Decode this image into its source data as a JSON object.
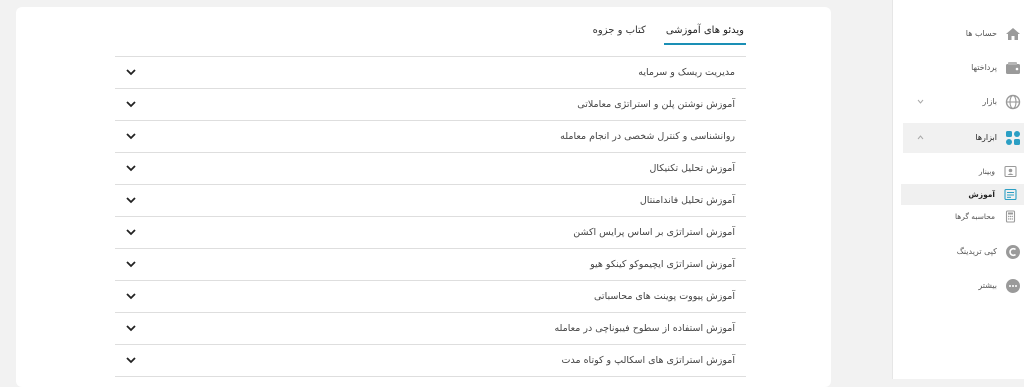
{
  "tabs": [
    {
      "label": "ویدئو های آموزشی",
      "active": true
    },
    {
      "label": "کتاب و جزوه",
      "active": false
    }
  ],
  "courses": [
    "مدیریت ریسک و سرمایه",
    "آموزش نوشتن پلن و استراتژی معاملاتی",
    "روانشناسی و کنترل شخصی در انجام معامله",
    "آموزش تحلیل تکنیکال",
    "آموزش تحلیل فاندامنتال",
    "آموزش استراتژی بر اساس پرایس اکشن",
    "آموزش استراتژی ایچیموکو کینکو هیو",
    "آموزش پیووت پوینت های محاسباتی",
    "آموزش استفاده از سطوح فیبوناچی در معامله",
    "آموزش استراتژی های اسکالپ و کوتاه مدت"
  ],
  "sidebar": {
    "items": [
      {
        "label": "حساب ها",
        "icon": "home-icon"
      },
      {
        "label": "پرداختها",
        "icon": "wallet-icon"
      },
      {
        "label": "بازار",
        "icon": "globe-icon"
      },
      {
        "label": "ابزارها",
        "icon": "tools-grid-icon"
      }
    ],
    "subitems": [
      {
        "label": "وبینار",
        "icon": "webinar-icon"
      },
      {
        "label": "آموزش",
        "icon": "education-icon"
      },
      {
        "label": "محاسبه گرها",
        "icon": "calculator-icon"
      }
    ],
    "more": [
      {
        "label": "کپی تریدینگ",
        "icon": "copy-trading-icon"
      },
      {
        "label": "بیشتر",
        "icon": "more-icon"
      }
    ]
  },
  "colors": {
    "accent": "#1a8fb5",
    "tools_icon": "#2b9fc4"
  }
}
